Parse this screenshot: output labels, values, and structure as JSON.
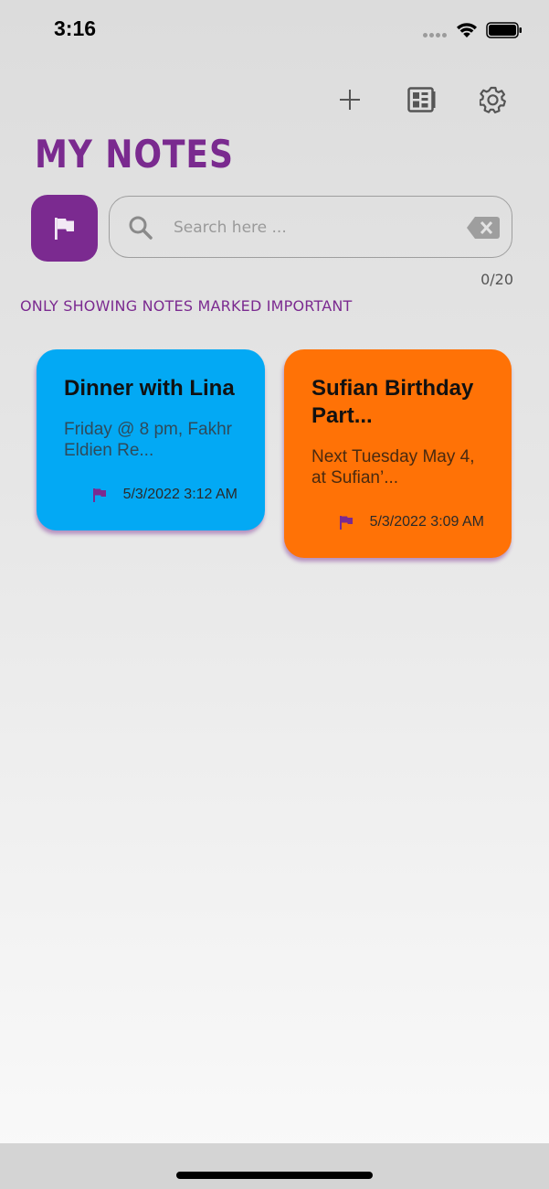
{
  "status_bar": {
    "time": "3:16"
  },
  "toolbar": {
    "add_icon": "plus-icon",
    "view_icon": "grid-view-icon",
    "settings_icon": "gear-icon"
  },
  "header": {
    "title": "MY NOTES"
  },
  "search": {
    "placeholder": "Search here ...",
    "value": "",
    "counter": "0/20"
  },
  "filter": {
    "message": "ONLY SHOWING NOTES MARKED IMPORTANT",
    "active": true
  },
  "notes": [
    {
      "title": "Dinner with Lina",
      "preview": "Friday @ 8 pm, Fakhr Eldien Re...",
      "timestamp": "5/3/2022 3:12 AM",
      "important": true,
      "color": "#03a9f4"
    },
    {
      "title": "Sufian Birthday Part...",
      "preview": "Next Tuesday May 4, at Sufian’...",
      "timestamp": "5/3/2022 3:09 AM",
      "important": true,
      "color": "#ff7206"
    }
  ],
  "colors": {
    "accent": "#7b2a90",
    "flag": "#7b2a90"
  }
}
